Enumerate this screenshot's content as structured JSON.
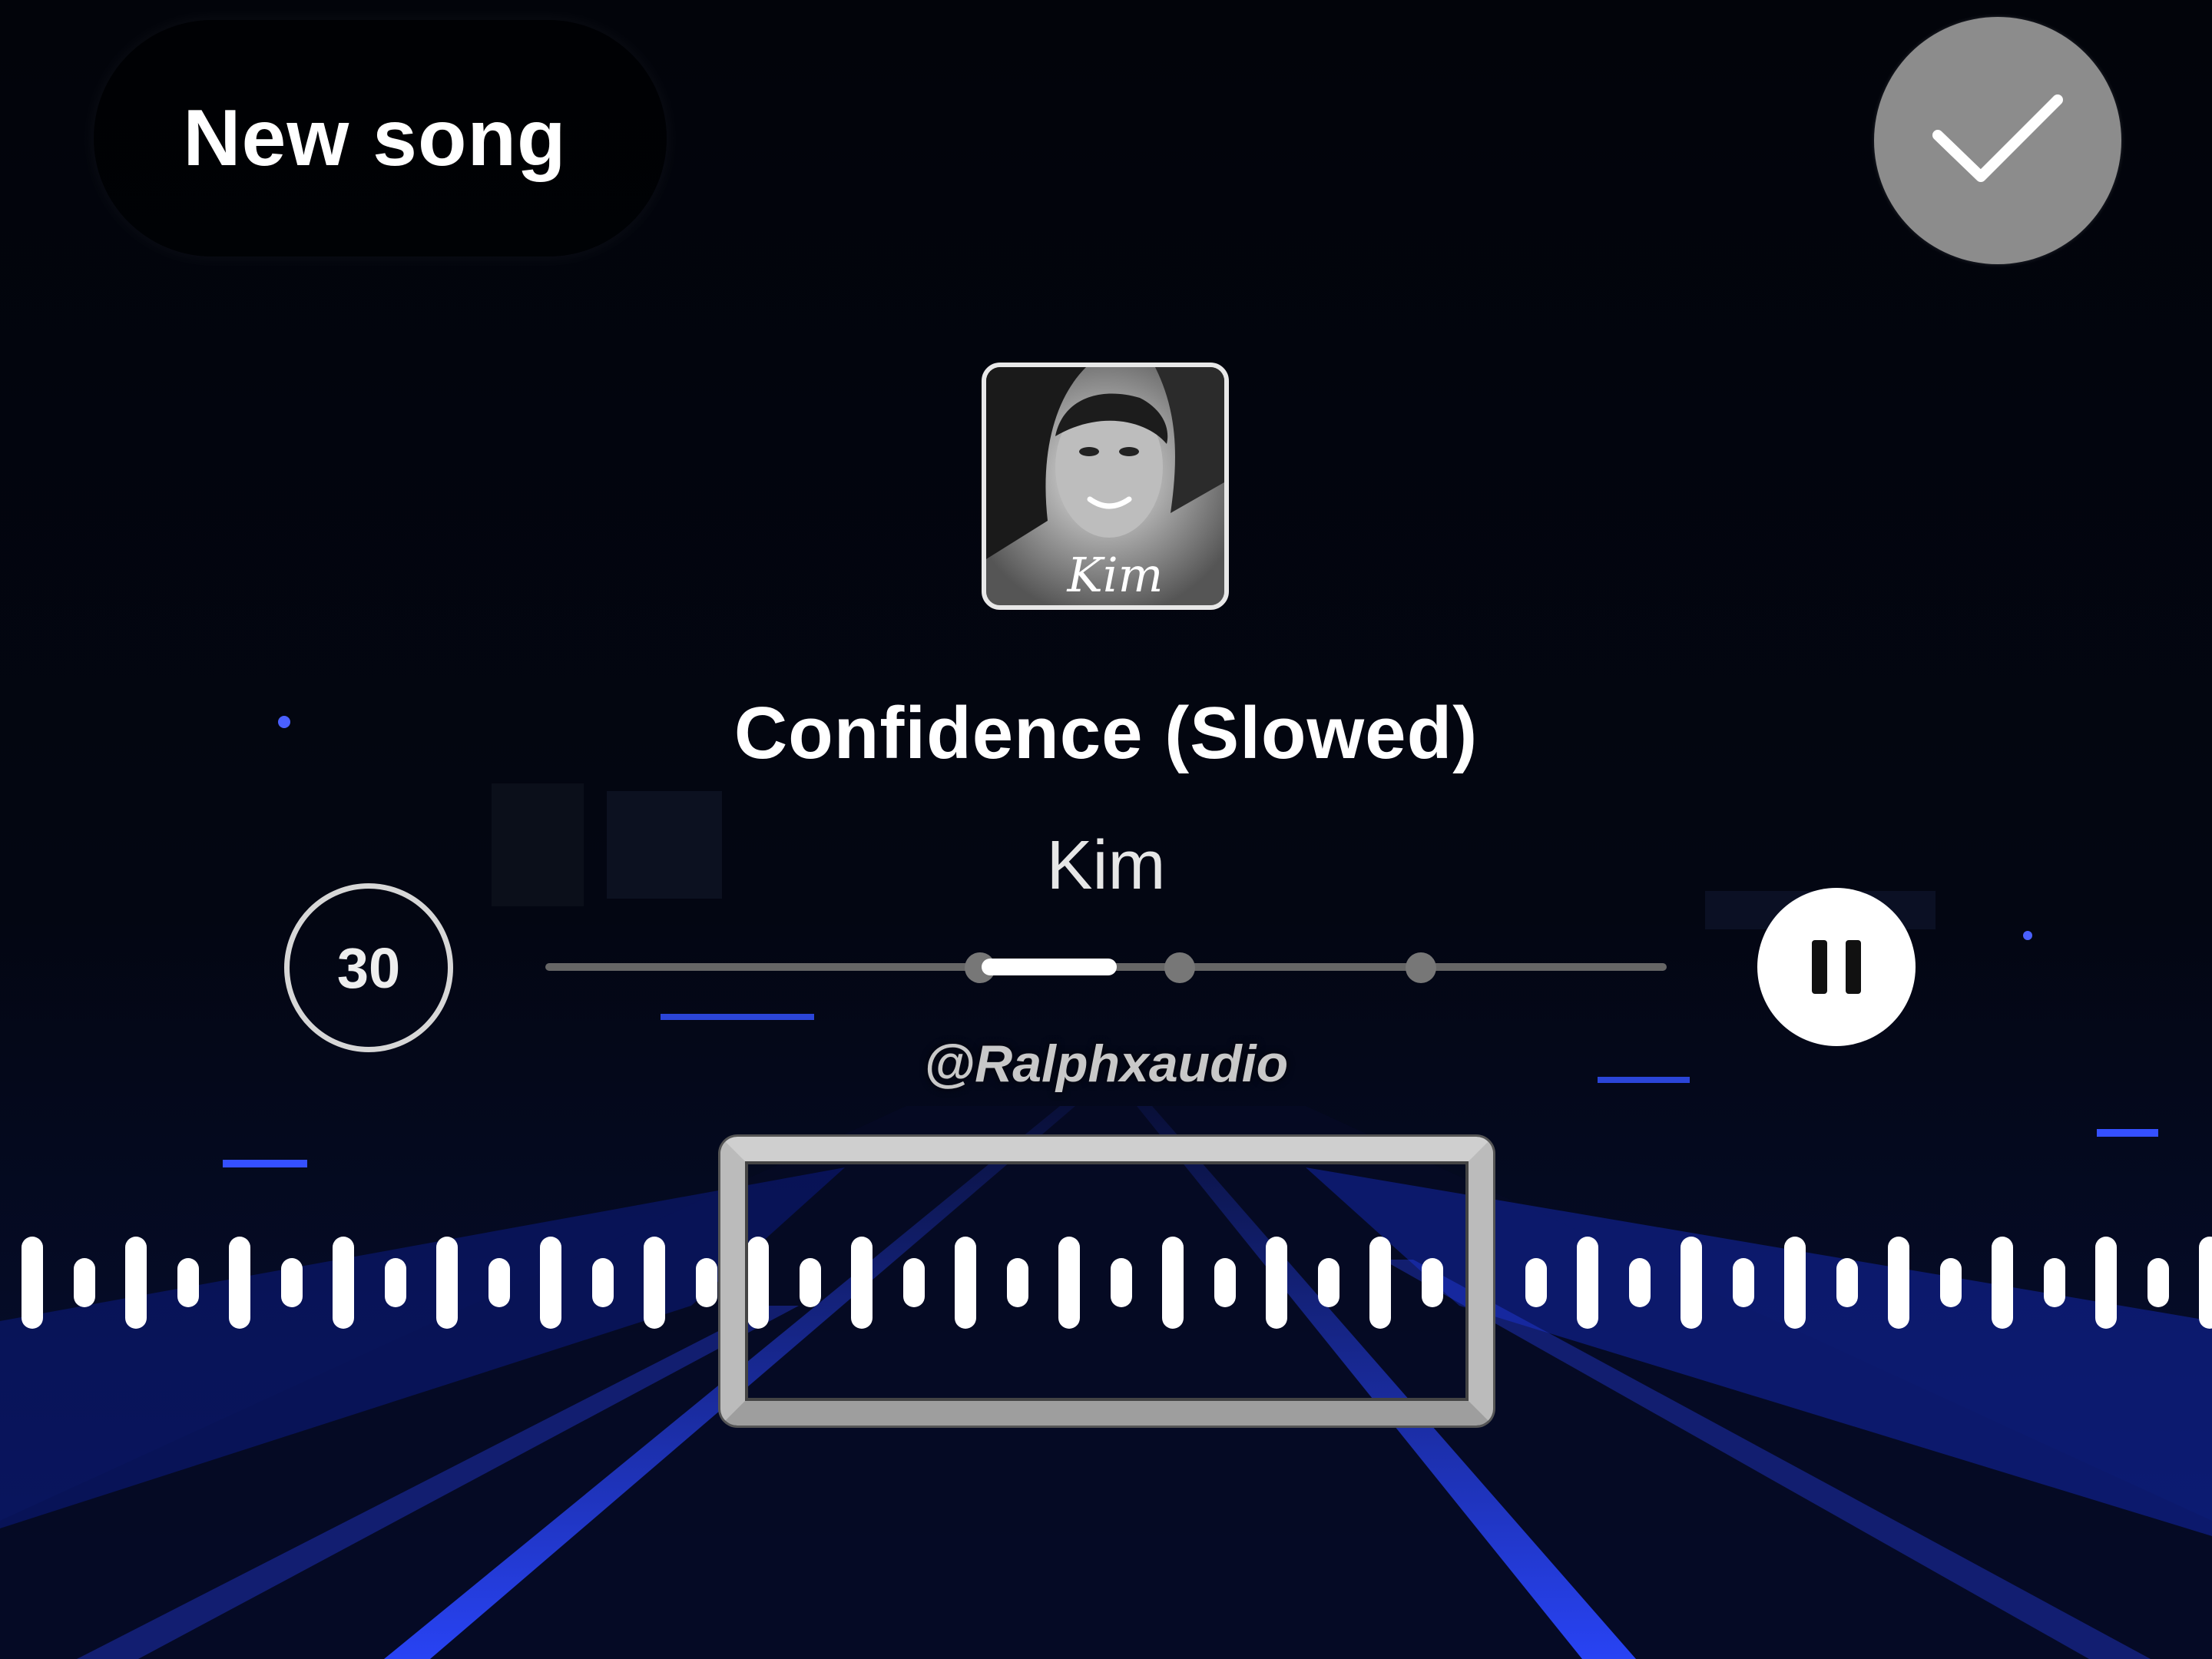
{
  "header": {
    "title": "New song",
    "done_icon": "checkmark-icon"
  },
  "track": {
    "title": "Confidence (Slowed)",
    "artist": "Kim",
    "album_art_text": "Kim"
  },
  "controls": {
    "duration": "30",
    "pause_icon": "pause-icon"
  },
  "watermark": "@Ralphxaudio",
  "colors": {
    "background": "#02040a",
    "road_light": "#1a3cff",
    "done_button": "#8c8c8c"
  }
}
